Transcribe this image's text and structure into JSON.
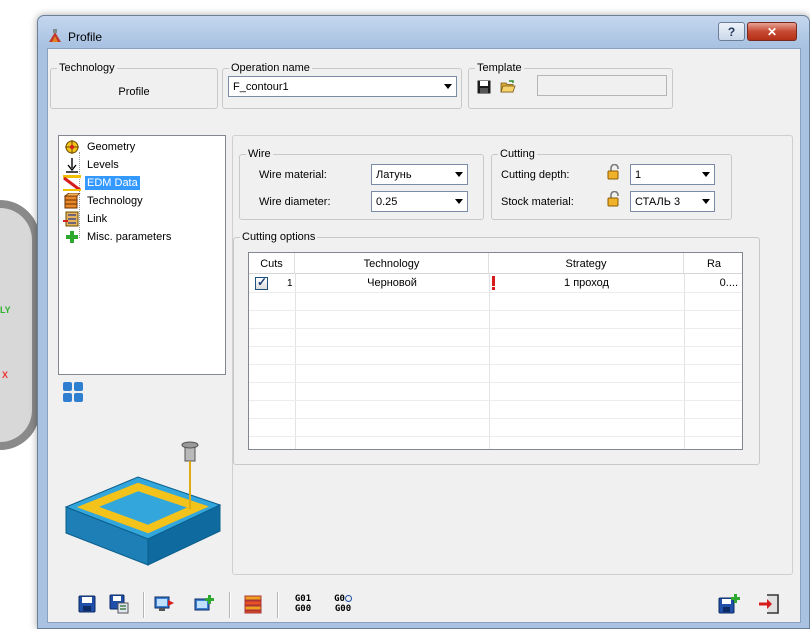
{
  "window": {
    "title": "Profile",
    "help_label": "?",
    "close_label": "✕"
  },
  "background": {
    "axis_y": "LY",
    "axis_x": "X"
  },
  "technology": {
    "legend": "Technology",
    "value": "Profile"
  },
  "operation": {
    "legend": "Operation name",
    "value": "F_contour1"
  },
  "template": {
    "legend": "Template",
    "value": ""
  },
  "tree": {
    "items": [
      {
        "label": "Geometry",
        "icon": "geometry-icon"
      },
      {
        "label": "Levels",
        "icon": "levels-icon"
      },
      {
        "label": "EDM Data",
        "icon": "edm-data-icon",
        "selected": true
      },
      {
        "label": "Technology",
        "icon": "technology-icon"
      },
      {
        "label": "Link",
        "icon": "link-icon"
      },
      {
        "label": "Misc. parameters",
        "icon": "misc-parameters-icon"
      }
    ]
  },
  "wire": {
    "legend": "Wire",
    "material_label": "Wire material:",
    "material_value": "Латунь",
    "diameter_label": "Wire diameter:",
    "diameter_value": "0.25"
  },
  "cutting": {
    "legend": "Cutting",
    "depth_label": "Cutting depth:",
    "depth_value": "1",
    "stock_label": "Stock material:",
    "stock_value": "СТАЛЬ 3"
  },
  "cutting_options": {
    "legend": "Cutting options",
    "columns": [
      "Cuts",
      "Technology",
      "Strategy",
      "Ra"
    ],
    "rows": [
      {
        "cuts": "1",
        "checked": true,
        "technology": "Черновой",
        "strategy": "1 проход",
        "ra": "0...."
      }
    ]
  },
  "bottom_toolbar": {
    "gcode1_top": "G01",
    "gcode1_bottom": "G00",
    "gcode2_top": "G0",
    "gcode2_bottom": "G00"
  }
}
